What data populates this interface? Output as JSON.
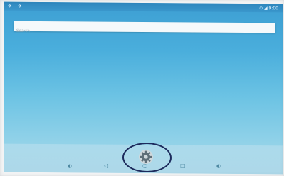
{
  "status_bar": {
    "left_icons": "✈ ✈",
    "right_text": "⊙ ◢ 9:00"
  },
  "search": {
    "placeholder": "Search"
  },
  "dock": {
    "apps": [
      {
        "icon": "settings-gear-icon"
      }
    ]
  },
  "nav_bar": {
    "buttons": [
      {
        "icon": "circle-icon",
        "glyph": "◐"
      },
      {
        "icon": "back-icon",
        "glyph": "◁"
      },
      {
        "icon": "home-icon",
        "glyph": "○"
      },
      {
        "icon": "recents-icon",
        "glyph": "□"
      },
      {
        "icon": "assistant-icon",
        "glyph": "◐"
      }
    ]
  },
  "colors": {
    "wallpaper_top": "#3d9fd3",
    "wallpaper_bottom": "#a6d9ea",
    "highlight_ring": "#1c2a5c"
  }
}
